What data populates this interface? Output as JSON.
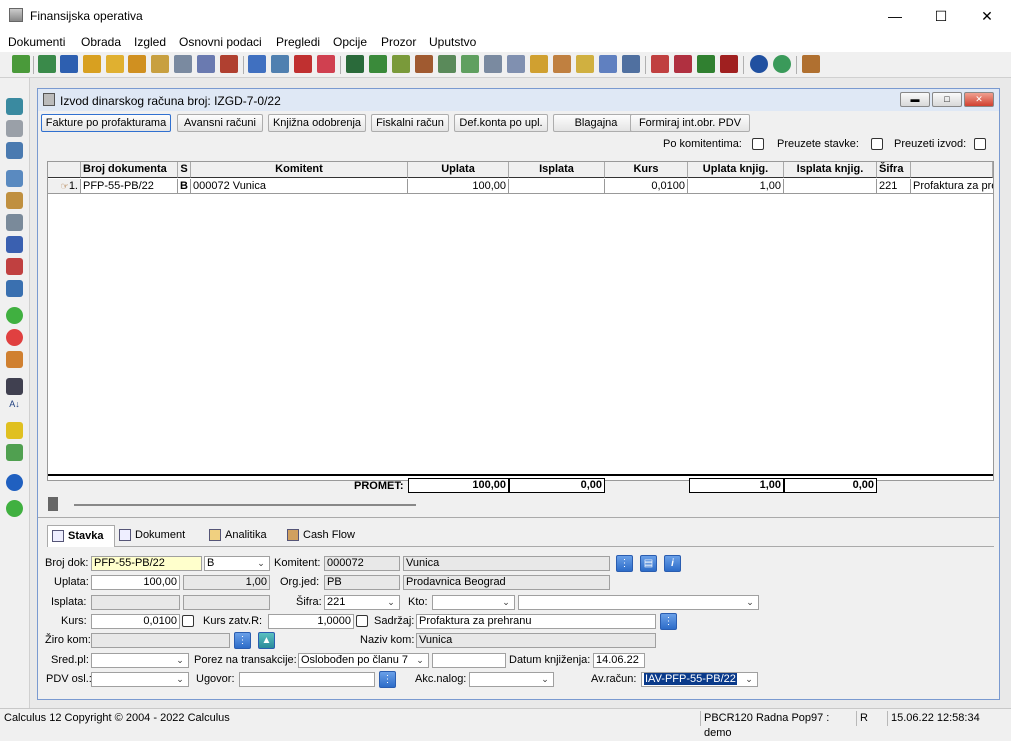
{
  "app": {
    "title": "Finansijska operativa"
  },
  "menu": [
    "Dokumenti",
    "Obrada",
    "Izgled",
    "Osnovni podaci",
    "Pregledi",
    "Opcije",
    "Prozor",
    "Uputstvo"
  ],
  "child": {
    "title": "Izvod dinarskog računa broj: IZGD-7-0/22",
    "buttons": [
      "Fakture po profakturama",
      "Avansni računi",
      "Knjižna odobrenja",
      "Fiskalni račun",
      "Def.konta po upl.",
      "Blagajna",
      "Formiraj int.obr. PDV"
    ],
    "checks": {
      "po_komitentima": "Po komitentima:",
      "preuzete_stavke": "Preuzete stavke:",
      "preuzeti_izvod": "Preuzeti izvod:"
    }
  },
  "grid": {
    "headers": [
      "Broj dokumenta",
      "S",
      "Komitent",
      "Uplata",
      "Isplata",
      "Kurs",
      "Uplata knjig.",
      "Isplata knjig.",
      "Šifra",
      ""
    ],
    "rows": [
      {
        "num": "1.",
        "broj": "PFP-55-PB/22",
        "s": "B",
        "komitent": "000072 Vunica",
        "uplata": "100,00",
        "isplata": "",
        "kurs": "0,0100",
        "uplata_knjig": "1,00",
        "isplata_knjig": "",
        "sifra": "221",
        "opis": "Profaktura za pre"
      }
    ],
    "totals": {
      "label": "PROMET:",
      "uplata": "100,00",
      "isplata": "0,00",
      "uplata_knjig": "1,00",
      "isplata_knjig": "0,00"
    }
  },
  "tabs": [
    "Stavka",
    "Dokument",
    "Analitika",
    "Cash Flow"
  ],
  "form": {
    "broj_dok_label": "Broj dok:",
    "broj_dok": "PFP-55-PB/22",
    "s_value": "B",
    "komitent_label": "Komitent:",
    "komitent_code": "000072",
    "komitent_name": "Vunica",
    "uplata_label": "Uplata:",
    "uplata": "100,00",
    "uplata_knjig": "1,00",
    "org_jed_label": "Org.jed:",
    "org_jed": "PB",
    "org_jed_name": "Prodavnica Beograd",
    "isplata_label": "Isplata:",
    "sifra_label": "Šifra:",
    "sifra": "221",
    "kto_label": "Kto:",
    "kurs_label": "Kurs:",
    "kurs": "0,0100",
    "kurs_zatv_label": "Kurs zatv.R:",
    "kurs_zatv": "1,0000",
    "sadrzaj_label": "Sadržaj:",
    "sadrzaj": "Profaktura za prehranu",
    "ziro_label": "Žiro kom:",
    "naziv_kom_label": "Naziv kom:",
    "naziv_kom": "Vunica",
    "sred_label": "Sred.pl:",
    "porez_label": "Porez na transakcije:",
    "porez": "Oslobođen po članu 7",
    "datum_label": "Datum knjiženja:",
    "datum": "14.06.22",
    "pdv_label": "PDV osl.:",
    "ugovor_label": "Ugovor:",
    "akc_label": "Akc.nalog:",
    "avracun_label": "Av.račun:",
    "avracun": "IAV-PFP-55-PB/22"
  },
  "status": {
    "left": "Calculus 12  Copyright © 2004 - 2022  Calculus",
    "station": "PBCR120 Radna Pop97 : demo",
    "mode": "R",
    "datetime": "15.06.22 12:58:34"
  }
}
